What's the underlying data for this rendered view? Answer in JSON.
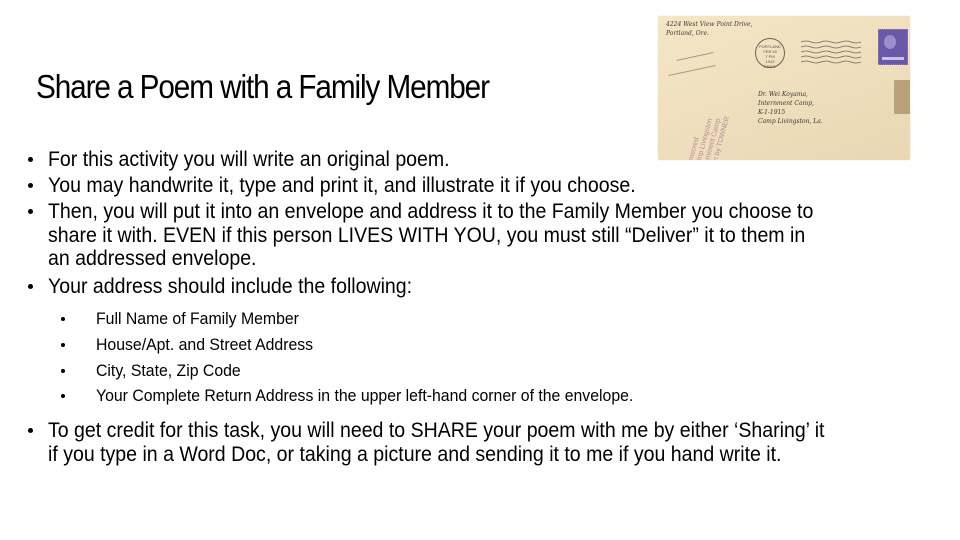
{
  "slide": {
    "title": "Share a Poem with a Family Member",
    "image": {
      "icon": "envelope-photo",
      "return_address": "4224 West View Point Drive,\nPortland, Ore.",
      "postmark": "PORTLAND\nFEB 28\n7 PM\n1943\nOREG.",
      "stamp": "3 cents",
      "recipient_address": "Dr. Wei Koyama,\nInternment Camp,\nK-1-1915\nCamp Livingston, La.",
      "censor_stamp": "Censored\nCamp Livingston\nInternment Camp\nSeen by TOWNER",
      "colors": {
        "paper": "#efdfbd",
        "stamp": "#6a58a8",
        "tape": "#b9a27a",
        "censor_ink": "#b58d9a"
      }
    },
    "bullets": [
      {
        "text": "For this activity you will write an original poem."
      },
      {
        "text": "You may handwrite it, type and print it, and illustrate it if you choose."
      },
      {
        "text": "Then, you will put it into an envelope and address it to the Family Member you choose to share it with. EVEN if this person LIVES WITH YOU, you must still “Deliver” it to them in an addressed envelope."
      },
      {
        "text": "Your address should include the following:",
        "sub_bullets": [
          "Full Name of Family Member",
          "House/Apt. and Street Address",
          "City, State, Zip Code",
          "Your Complete Return Address in the upper left-hand corner of the envelope."
        ]
      },
      {
        "text": "To get credit for this task, you will need to SHARE your poem with me by either ‘Sharing’ it if you type in a Word Doc, or taking a picture and sending it to me if you hand write it."
      }
    ]
  }
}
